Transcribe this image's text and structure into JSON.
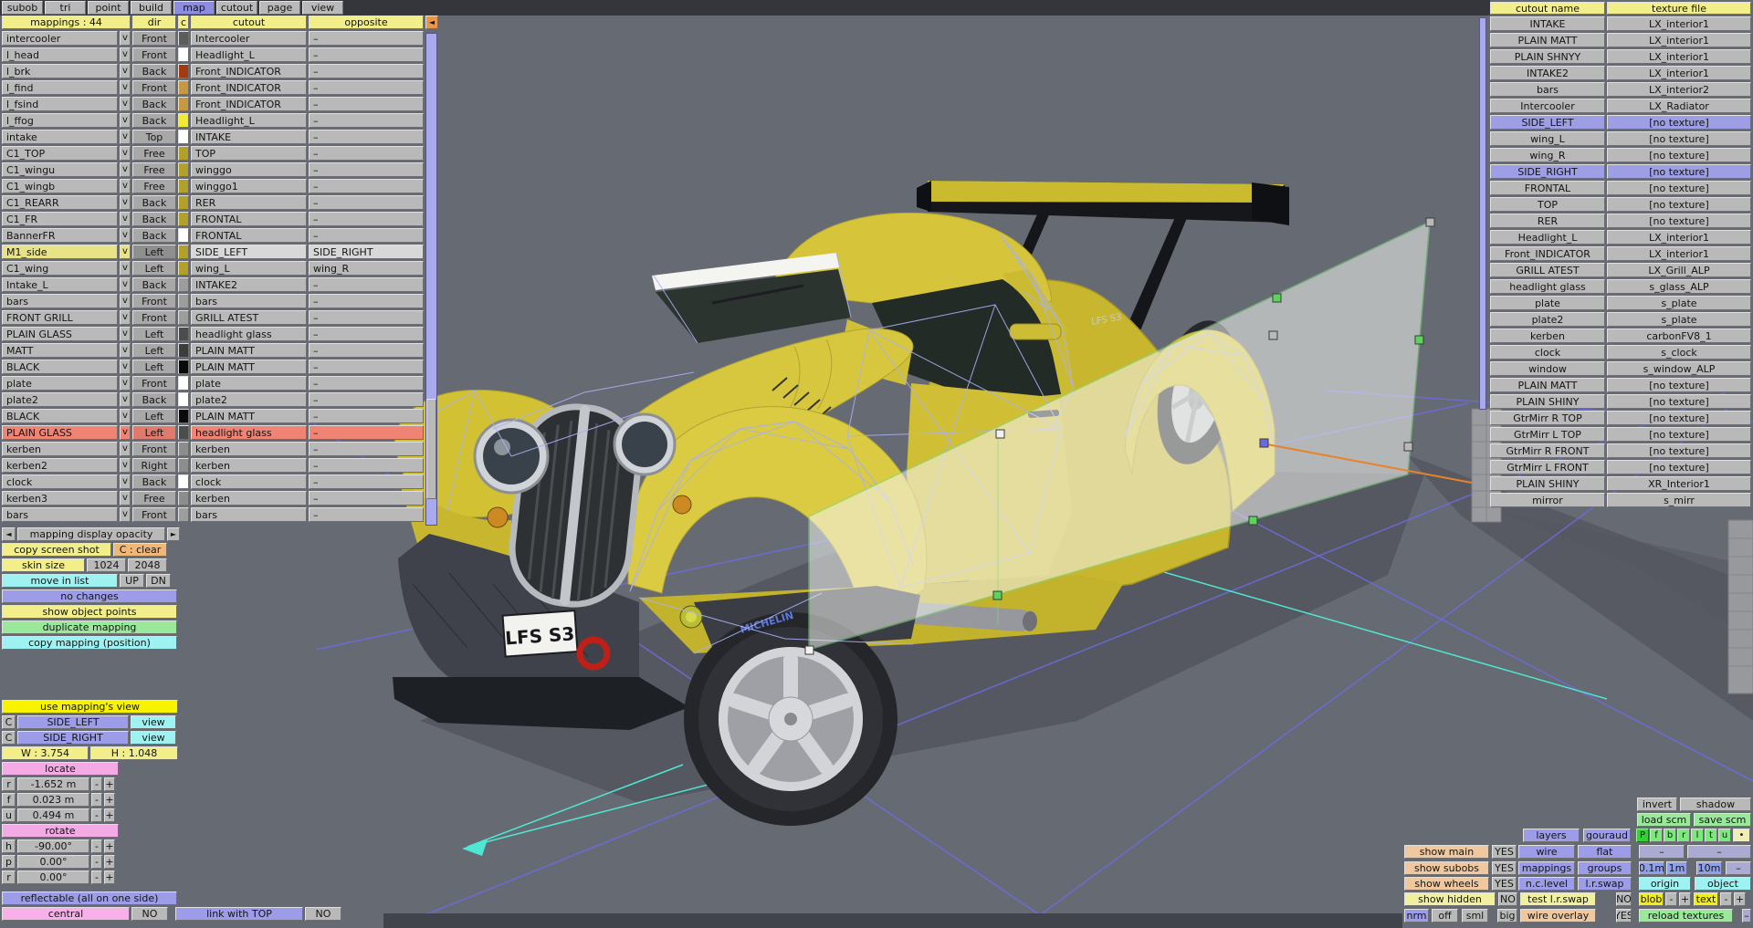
{
  "menu": {
    "tabs": [
      {
        "label": "subob",
        "cls": ""
      },
      {
        "label": "tri",
        "cls": ""
      },
      {
        "label": "point",
        "cls": ""
      },
      {
        "label": "build",
        "cls": ""
      },
      {
        "label": "map",
        "cls": "active"
      },
      {
        "label": "cutout",
        "cls": ""
      },
      {
        "label": "page",
        "cls": ""
      },
      {
        "label": "view",
        "cls": ""
      }
    ]
  },
  "mapping_table": {
    "title": "mappings : 44",
    "dir_header": "dir",
    "c_header": "c",
    "cutout_header": "cutout",
    "opposite_header": "opposite",
    "collapse_arrow": "◄",
    "check": "v",
    "rows": [
      {
        "name": "intercooler",
        "dir": "Front",
        "color": "#5c5c5c",
        "cutout": "Intercooler",
        "opposite": "–",
        "cls": ""
      },
      {
        "name": "l_head",
        "dir": "Front",
        "color": "#ffffff",
        "cutout": "Headlight_L",
        "opposite": "–",
        "cls": ""
      },
      {
        "name": "l_brk",
        "dir": "Back",
        "color": "#a33b12",
        "cutout": "Front_INDICATOR",
        "opposite": "–",
        "cls": ""
      },
      {
        "name": "l_find",
        "dir": "Front",
        "color": "#c79842",
        "cutout": "Front_INDICATOR",
        "opposite": "–",
        "cls": ""
      },
      {
        "name": "l_fsind",
        "dir": "Back",
        "color": "#c79842",
        "cutout": "Front_INDICATOR",
        "opposite": "–",
        "cls": ""
      },
      {
        "name": "l_ffog",
        "dir": "Back",
        "color": "#f2ea32",
        "cutout": "Headlight_L",
        "opposite": "–",
        "cls": ""
      },
      {
        "name": "intake",
        "dir": "Top",
        "color": "#ffffff",
        "cutout": "INTAKE",
        "opposite": "–",
        "cls": ""
      },
      {
        "name": "C1_TOP",
        "dir": "Free",
        "color": "#b3a02a",
        "cutout": "TOP",
        "opposite": "–",
        "cls": ""
      },
      {
        "name": "C1_wingu",
        "dir": "Free",
        "color": "#b3a02a",
        "cutout": "winggo",
        "opposite": "–",
        "cls": ""
      },
      {
        "name": "C1_wingb",
        "dir": "Free",
        "color": "#b3a02a",
        "cutout": "winggo1",
        "opposite": "–",
        "cls": ""
      },
      {
        "name": "C1_REARR",
        "dir": "Back",
        "color": "#b3a02a",
        "cutout": "RER",
        "opposite": "–",
        "cls": ""
      },
      {
        "name": "C1_FR",
        "dir": "Back",
        "color": "#b3a02a",
        "cutout": "FRONTAL",
        "opposite": "–",
        "cls": ""
      },
      {
        "name": "BannerFR",
        "dir": "Back",
        "color": "#ffffff",
        "cutout": "FRONTAL",
        "opposite": "–",
        "cls": ""
      },
      {
        "name": "M1_side",
        "dir": "Left",
        "color": "#b3a02a",
        "cutout": "SIDE_LEFT",
        "opposite": "SIDE_RIGHT",
        "cls": "row-m1"
      },
      {
        "name": "C1_wing",
        "dir": "Left",
        "color": "#b3a02a",
        "cutout": "wing_L",
        "opposite": "wing_R",
        "cls": ""
      },
      {
        "name": "Intake_L",
        "dir": "Back",
        "color": "#9d9d9d",
        "cutout": "INTAKE2",
        "opposite": "–",
        "cls": ""
      },
      {
        "name": "bars",
        "dir": "Front",
        "color": "#9d9d9d",
        "cutout": "bars",
        "opposite": "–",
        "cls": ""
      },
      {
        "name": "FRONT GRILL",
        "dir": "Front",
        "color": "#9d9d9d",
        "cutout": "GRILL ATEST",
        "opposite": "–",
        "cls": ""
      },
      {
        "name": "PLAIN GLASS",
        "dir": "Left",
        "color": "#4c4c4c",
        "cutout": "headlight glass",
        "opposite": "–",
        "cls": ""
      },
      {
        "name": "MATT",
        "dir": "Left",
        "color": "#3c3c3c",
        "cutout": "PLAIN MATT",
        "opposite": "–",
        "cls": ""
      },
      {
        "name": "BLACK",
        "dir": "Left",
        "color": "#0a0a0a",
        "cutout": "PLAIN MATT",
        "opposite": "–",
        "cls": ""
      },
      {
        "name": "plate",
        "dir": "Front",
        "color": "#ffffff",
        "cutout": "plate",
        "opposite": "–",
        "cls": ""
      },
      {
        "name": "plate2",
        "dir": "Back",
        "color": "#ffffff",
        "cutout": "plate2",
        "opposite": "–",
        "cls": ""
      },
      {
        "name": "BLACK",
        "dir": "Left",
        "color": "#0a0a0a",
        "cutout": "PLAIN MATT",
        "opposite": "–",
        "cls": ""
      },
      {
        "name": "PLAIN GLASS",
        "dir": "Left",
        "color": "#4c4c4c",
        "cutout": "headlight glass",
        "opposite": "–",
        "cls": "row-red"
      },
      {
        "name": "kerben",
        "dir": "Front",
        "color": "#8d8d8d",
        "cutout": "kerben",
        "opposite": "–",
        "cls": ""
      },
      {
        "name": "kerben2",
        "dir": "Right",
        "color": "#8d8d8d",
        "cutout": "kerben",
        "opposite": "–",
        "cls": ""
      },
      {
        "name": "clock",
        "dir": "Back",
        "color": "#ffffff",
        "cutout": "clock",
        "opposite": "–",
        "cls": ""
      },
      {
        "name": "kerben3",
        "dir": "Free",
        "color": "#8d8d8d",
        "cutout": "kerben",
        "opposite": "–",
        "cls": ""
      },
      {
        "name": "bars",
        "dir": "Front",
        "color": "#9d9d9d",
        "cutout": "bars",
        "opposite": "–",
        "cls": ""
      }
    ]
  },
  "left_controls": {
    "arrow_left": "◄",
    "arrow_right": "►",
    "opacity_label": "mapping display opacity",
    "copy_screen_shot": "copy screen shot",
    "clear": "C : clear",
    "skin_size": "skin size",
    "s1024": "1024",
    "s2048": "2048",
    "move_in_list": "move in list",
    "up": "UP",
    "dn": "DN",
    "no_changes": "no changes",
    "show_object_points": "show object points",
    "duplicate_mapping": "duplicate mapping",
    "copy_mapping_position": "copy mapping (position)"
  },
  "view_panel": {
    "use_mappings_view": "use mapping's view",
    "c": "C",
    "side_left": "SIDE_LEFT",
    "side_right": "SIDE_RIGHT",
    "view": "view",
    "w": "W : 3.754",
    "h": "H : 1.048"
  },
  "locate": {
    "title": "locate",
    "minus": "-",
    "plus": "+",
    "rows": [
      {
        "k": "r",
        "v": "-1.652 m"
      },
      {
        "k": "f",
        "v": "0.023 m"
      },
      {
        "k": "u",
        "v": "0.494 m"
      }
    ]
  },
  "rotate": {
    "title": "rotate",
    "minus": "-",
    "plus": "+",
    "rows": [
      {
        "k": "h",
        "v": "-90.00°"
      },
      {
        "k": "p",
        "v": "0.00°"
      },
      {
        "k": "r",
        "v": "0.00°"
      }
    ]
  },
  "bottom_left": {
    "reflectable": "reflectable (all on one side)",
    "central": "central",
    "no1": "NO",
    "link_with_top": "link with TOP",
    "no2": "NO"
  },
  "cutout_table": {
    "name_header": "cutout name",
    "file_header": "texture file",
    "rows": [
      {
        "name": "INTAKE",
        "file": "LX_interior1",
        "cls": ""
      },
      {
        "name": "PLAIN MATT",
        "file": "LX_interior1",
        "cls": ""
      },
      {
        "name": "PLAIN SHNYY",
        "file": "LX_interior1",
        "cls": ""
      },
      {
        "name": "INTAKE2",
        "file": "LX_interior1",
        "cls": ""
      },
      {
        "name": "bars",
        "file": "LX_interior2",
        "cls": ""
      },
      {
        "name": "Intercooler",
        "file": "LX_Radiator",
        "cls": ""
      },
      {
        "name": "SIDE_LEFT",
        "file": "[no texture]",
        "cls": "rsel"
      },
      {
        "name": "wing_L",
        "file": "[no texture]",
        "cls": ""
      },
      {
        "name": "wing_R",
        "file": "[no texture]",
        "cls": ""
      },
      {
        "name": "SIDE_RIGHT",
        "file": "[no texture]",
        "cls": "rsel"
      },
      {
        "name": "FRONTAL",
        "file": "[no texture]",
        "cls": ""
      },
      {
        "name": "TOP",
        "file": "[no texture]",
        "cls": ""
      },
      {
        "name": "RER",
        "file": "[no texture]",
        "cls": ""
      },
      {
        "name": "Headlight_L",
        "file": "LX_interior1",
        "cls": ""
      },
      {
        "name": "Front_INDICATOR",
        "file": "LX_interior1",
        "cls": ""
      },
      {
        "name": "GRILL ATEST",
        "file": "LX_Grill_ALP",
        "cls": ""
      },
      {
        "name": "headlight glass",
        "file": "s_glass_ALP",
        "cls": ""
      },
      {
        "name": "plate",
        "file": "s_plate",
        "cls": ""
      },
      {
        "name": "plate2",
        "file": "s_plate",
        "cls": ""
      },
      {
        "name": "kerben",
        "file": "carbonFV8_1",
        "cls": ""
      },
      {
        "name": "clock",
        "file": "s_clock",
        "cls": ""
      },
      {
        "name": "window",
        "file": "s_window_ALP",
        "cls": ""
      },
      {
        "name": "PLAIN MATT",
        "file": "[no texture]",
        "cls": ""
      },
      {
        "name": "PLAIN SHINY",
        "file": "[no texture]",
        "cls": ""
      },
      {
        "name": "GtrMirr R TOP",
        "file": "[no texture]",
        "cls": ""
      },
      {
        "name": "GtrMirr L TOP",
        "file": "[no texture]",
        "cls": ""
      },
      {
        "name": "GtrMirr R FRONT",
        "file": "[no texture]",
        "cls": ""
      },
      {
        "name": "GtrMirr L FRONT",
        "file": "[no texture]",
        "cls": ""
      },
      {
        "name": "PLAIN SHINY",
        "file": "XR_Interior1",
        "cls": ""
      },
      {
        "name": "mirror",
        "file": "s_mirr",
        "cls": ""
      }
    ]
  },
  "bottom_right": {
    "invert": "invert",
    "shadow": "shadow",
    "load_scm": "load scm",
    "save_scm": "save scm",
    "layers": "layers",
    "gouraud": "gouraud",
    "proj": [
      {
        "label": "P",
        "cls": "active"
      },
      {
        "label": "f",
        "cls": ""
      },
      {
        "label": "b",
        "cls": ""
      },
      {
        "label": "r",
        "cls": ""
      },
      {
        "label": "l",
        "cls": ""
      },
      {
        "label": "t",
        "cls": ""
      },
      {
        "label": "u",
        "cls": ""
      }
    ],
    "dot": "•",
    "show_main": "show main",
    "show_subobs": "show subobs",
    "show_wheels": "show wheels",
    "show_hidden": "show hidden",
    "yes": "YES",
    "no": "NO",
    "wire": "wire",
    "flat": "flat",
    "dash": "–",
    "mappings": "mappings",
    "groups": "groups",
    "m01": "0.1m",
    "m1": "1m",
    "m10": "10m",
    "nc_level": "n.c.level",
    "lr_swap": "l.r.swap",
    "origin": "origin",
    "object": "object",
    "test_lr_swap": "test l.r.swap",
    "blob": "blob",
    "minus": "-",
    "plus": "+",
    "text_btn": "text",
    "nrm": "nrm",
    "off": "off",
    "sml": "sml",
    "big": "big",
    "wire_overlay": "wire overlay",
    "reload_textures": "reload textures"
  },
  "viewport": {
    "plate_text": "LFS S3",
    "window_text": "LFS S3",
    "tire_brand": "MICHELIN",
    "colors": {
      "background": "#666a72",
      "grid": "#6c6ce4",
      "wireframe": "#a9b0f2",
      "plane_outline": "#7fdc7f",
      "orange_axis": "#e8832a",
      "cyan_guide": "#4fe6d4",
      "car_yellow": "#d2c133"
    }
  }
}
